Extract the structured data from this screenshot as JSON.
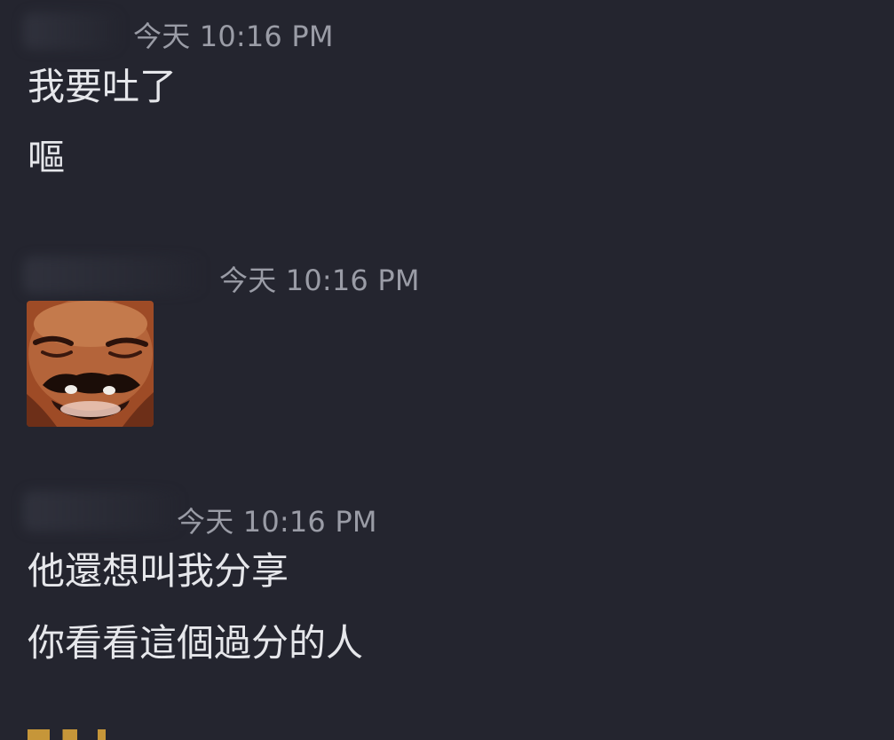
{
  "messages": [
    {
      "timestamp": "今天 10:16 PM",
      "lines": [
        "我要吐了",
        "嘔"
      ]
    },
    {
      "timestamp": "今天 10:16 PM",
      "image_label": "laughing-man-emoji"
    },
    {
      "timestamp": "今天 10:16 PM",
      "lines": [
        "他還想叫我分享",
        "你看看這個過分的人"
      ]
    }
  ]
}
